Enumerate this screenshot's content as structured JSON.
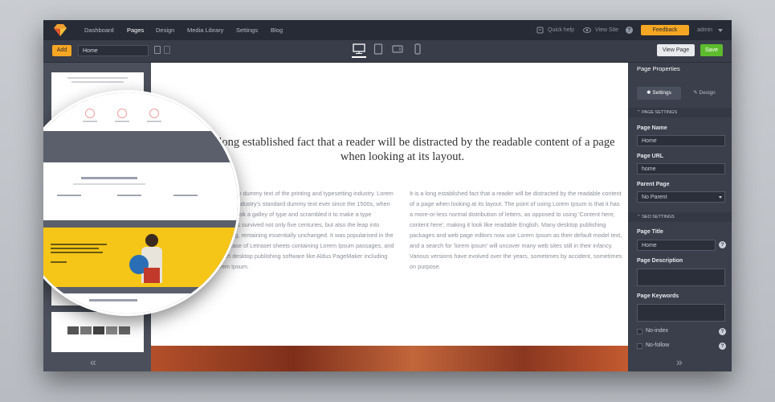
{
  "nav": {
    "items": [
      "Dashboard",
      "Pages",
      "Design",
      "Media Library",
      "Settings",
      "Blog"
    ],
    "active": "Pages",
    "quick_help": "Quick help",
    "view_site": "View Site",
    "help_glyph": "?",
    "feedback": "Feedback",
    "user": "admin"
  },
  "toolbar": {
    "add_label": "Add",
    "page_value": "Home",
    "view_page_label": "View Page",
    "save_label": "Save",
    "devices": [
      "desktop-icon",
      "tablet-icon",
      "tablet-landscape-icon",
      "mobile-icon"
    ],
    "active_device": "desktop-icon"
  },
  "left_panel": {
    "collapse_glyph": "«"
  },
  "canvas": {
    "headline": "It is a long established fact that a reader will be distracted by the readable content of a page when looking at its layout.",
    "col_left": "Lorem Ipsum is simply dummy text of the printing and typesetting industry. Lorem Ipsum has been the industry's standard dummy text ever since the 1500s, when an unknown printer took a galley of type and scrambled it to make a type specimen book. It has survived not only five centuries, but also the leap into electronic typesetting, remaining essentially unchanged. It was popularised in the 1960s with the release of Letraset sheets containing Lorem Ipsum passages, and more recently with desktop publishing software like Aldus PageMaker including versions of Lorem Ipsum.",
    "col_right": "It is a long established fact that a reader will be distracted by the readable content of a page when looking at its layout. The point of using Lorem Ipsum is that it has a more-or-less normal distribution of letters, as opposed to using 'Content here, content here', making it look like readable English. Many desktop publishing packages and web page editors now use Lorem Ipsum as their default model text, and a search for 'lorem ipsum' will uncover many web sites still in their infancy. Various versions have evolved over the years, sometimes by accident, sometimes on purpose."
  },
  "right_panel": {
    "title": "Page Properties",
    "tabs": [
      "Settings",
      "Design"
    ],
    "page_settings_header": "PAGE SETTINGS",
    "page_name_label": "Page Name",
    "page_name_value": "Home",
    "page_url_label": "Page URL",
    "page_url_value": "home",
    "parent_page_label": "Parent Page",
    "parent_page_value": "No Parent",
    "seo_settings_header": "SEO SETTINGS",
    "page_title_label": "Page Title",
    "page_title_value": "Home",
    "page_description_label": "Page Description",
    "page_keywords_label": "Page Keywords",
    "no_index_label": "No-index",
    "no_follow_label": "No-follow",
    "help_glyph": "?",
    "collapse_glyph": "»"
  },
  "colors": {
    "accent_orange": "#f5a623",
    "save_green": "#5dbb2e",
    "yellow_banner": "#f5c518"
  }
}
